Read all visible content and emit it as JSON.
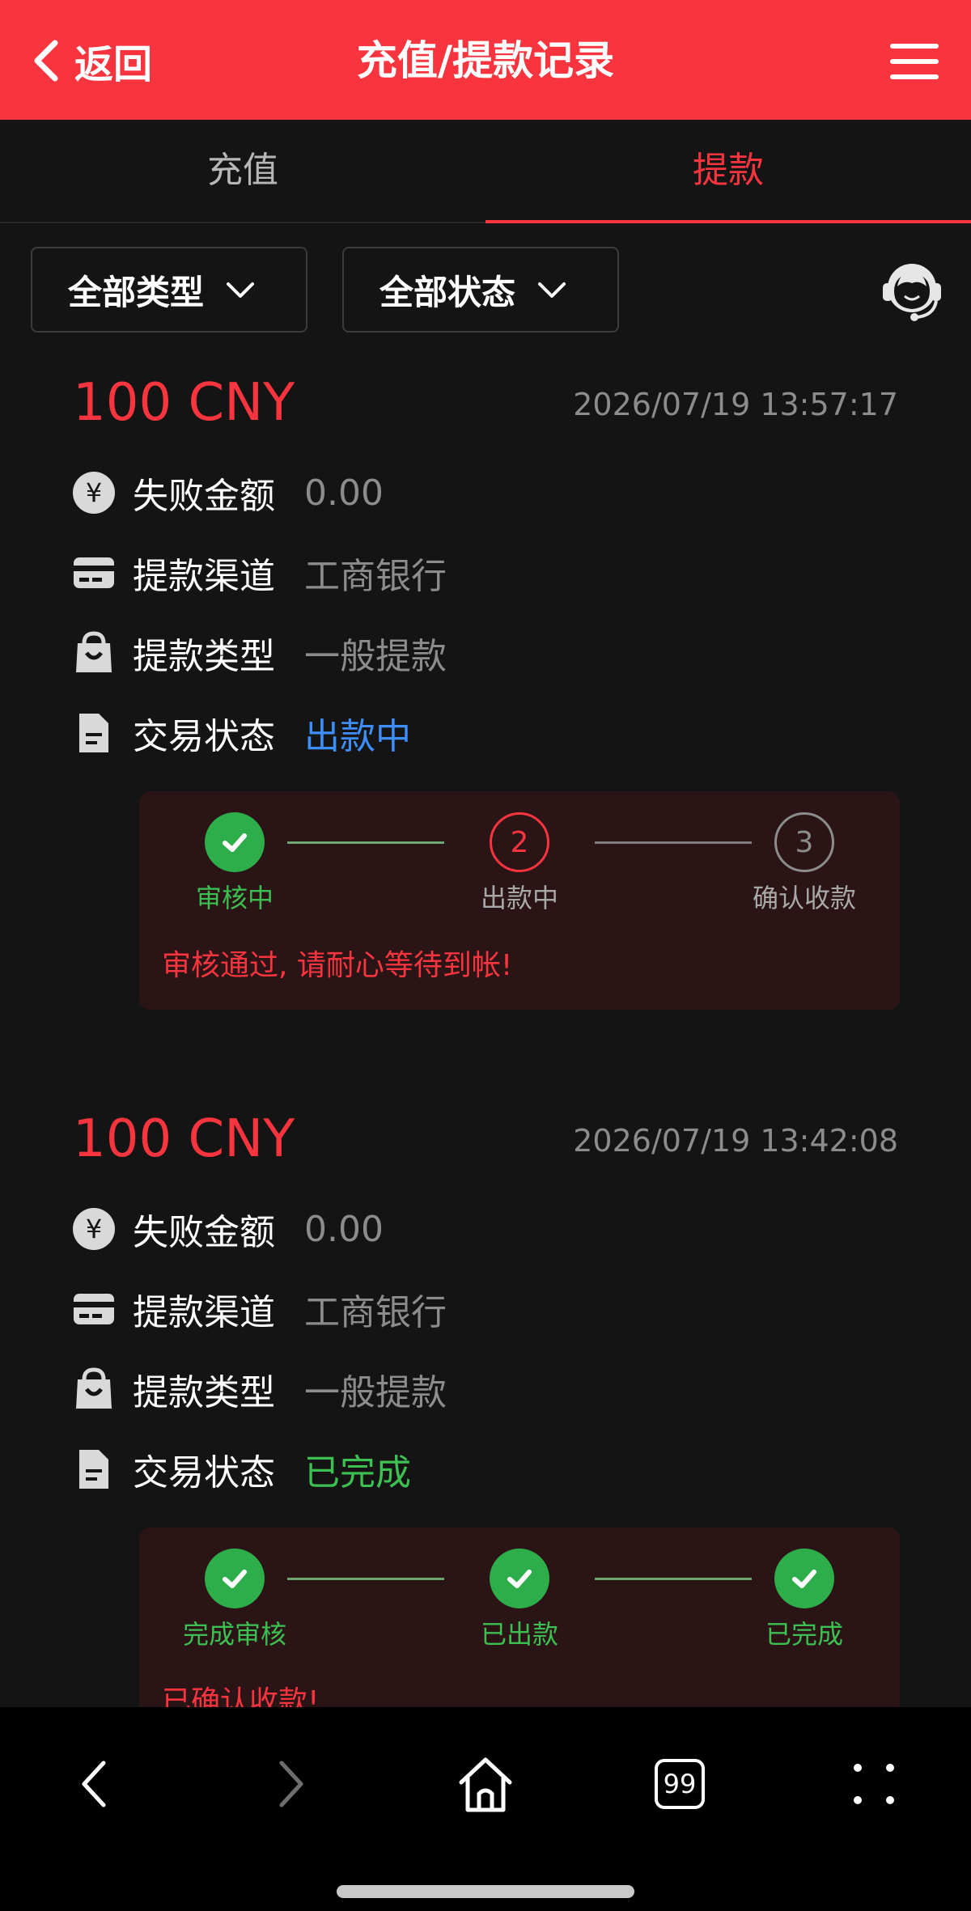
{
  "header": {
    "back_label": "返回",
    "title": "充值/提款记录"
  },
  "tabs": [
    {
      "label": "充值"
    },
    {
      "label": "提款"
    }
  ],
  "filters": {
    "type": "全部类型",
    "status": "全部状态"
  },
  "labels": {
    "fail_amount": "失败金额",
    "channel": "提款渠道",
    "type": "提款类型",
    "status": "交易状态"
  },
  "records": [
    {
      "amount": "100 CNY",
      "time": "2026/07/19 13:57:17",
      "fail_amount": "0.00",
      "channel": "工商银行",
      "type": "一般提款",
      "status": "出款中",
      "steps": [
        {
          "number": "",
          "label": "审核中"
        },
        {
          "number": "2",
          "label": "出款中"
        },
        {
          "number": "3",
          "label": "确认收款"
        }
      ],
      "message": "审核通过, 请耐心等待到帐!"
    },
    {
      "amount": "100 CNY",
      "time": "2026/07/19 13:42:08",
      "fail_amount": "0.00",
      "channel": "工商银行",
      "type": "一般提款",
      "status": "已完成",
      "steps": [
        {
          "number": "",
          "label": "完成审核"
        },
        {
          "number": "",
          "label": "已出款"
        },
        {
          "number": "",
          "label": "已完成"
        }
      ],
      "message": "已确认收款!"
    }
  ],
  "colors": {
    "accent": "#f8353f",
    "status_processing": "#3d8ef8",
    "status_done": "#3cc051",
    "background": "#141414"
  },
  "icons": [
    "chevron-left-icon",
    "menu-icon",
    "chevron-down-icon",
    "customer-service-icon",
    "yen-icon",
    "card-icon",
    "bag-icon",
    "document-icon",
    "check-icon",
    "nav-back-icon",
    "nav-forward-icon",
    "home-icon",
    "tabs-icon",
    "more-icon"
  ],
  "sysbar": {
    "tabs_count": "99"
  }
}
